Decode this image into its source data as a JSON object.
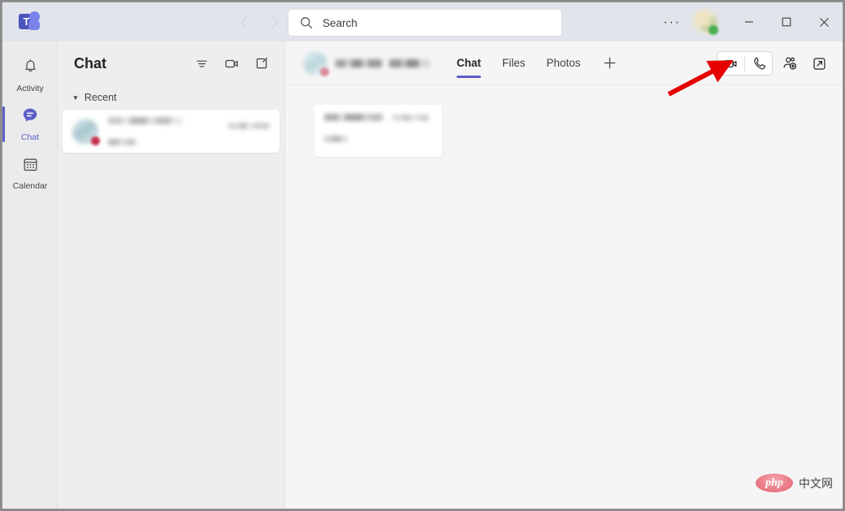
{
  "app": {
    "name": "Microsoft Teams",
    "logo_icon": "teams-logo-icon",
    "logo_letter": "T"
  },
  "titlebar": {
    "back_icon": "chevron-left-icon",
    "forward_icon": "chevron-right-icon",
    "search": {
      "icon": "search-icon",
      "placeholder": "Search",
      "value": "Search"
    },
    "more_label": "···",
    "more_icon": "ellipsis-icon",
    "avatar_icon": "user-avatar",
    "presence_status": "available",
    "presence_color": "#4caf50",
    "minimize_icon": "minimize-icon",
    "maximize_icon": "maximize-icon",
    "close_icon": "close-icon"
  },
  "rail": {
    "items": [
      {
        "label": "Activity",
        "icon": "bell-icon",
        "active": false
      },
      {
        "label": "Chat",
        "icon": "chat-bubble-icon",
        "active": true
      },
      {
        "label": "Calendar",
        "icon": "calendar-icon",
        "active": false
      }
    ],
    "accent_color": "#5b5fc7"
  },
  "chat_panel": {
    "title": "Chat",
    "icons": [
      {
        "name": "filter-icon",
        "label": "Filter"
      },
      {
        "name": "video-call-icon",
        "label": "Meet now"
      },
      {
        "name": "compose-icon",
        "label": "New chat"
      }
    ],
    "section": {
      "label": "Recent",
      "chevron_icon": "chevron-down-icon"
    },
    "items": [
      {
        "name": "[redacted]",
        "timestamp": "[redacted]",
        "preview": "[redacted]",
        "avatar_icon": "contact-avatar",
        "presence_status": "busy",
        "presence_color": "#c4314b",
        "selected": true
      }
    ]
  },
  "conversation": {
    "avatar_icon": "contact-avatar",
    "presence_color": "#d98a9a",
    "title": "[redacted]",
    "subtitle": "[redacted]",
    "tabs": [
      {
        "label": "Chat",
        "active": true
      },
      {
        "label": "Files",
        "active": false
      },
      {
        "label": "Photos",
        "active": false
      }
    ],
    "add_tab_icon": "plus-icon",
    "actions": [
      {
        "name": "video-call-button",
        "icon": "video-camera-icon",
        "label": "Video call"
      },
      {
        "name": "audio-call-button",
        "icon": "phone-icon",
        "label": "Audio call"
      },
      {
        "name": "add-people-button",
        "icon": "add-person-icon",
        "label": "Add people"
      },
      {
        "name": "pop-out-button",
        "icon": "pop-out-icon",
        "label": "Pop out chat"
      }
    ],
    "messages": [
      {
        "sender": "[redacted]",
        "timestamp": "[redacted]",
        "text": "[redacted]"
      }
    ]
  },
  "annotation": {
    "type": "arrow",
    "color": "#e60000",
    "points_to": "video-call-button"
  },
  "watermark": {
    "badge_text": "php",
    "text": "中文网"
  }
}
